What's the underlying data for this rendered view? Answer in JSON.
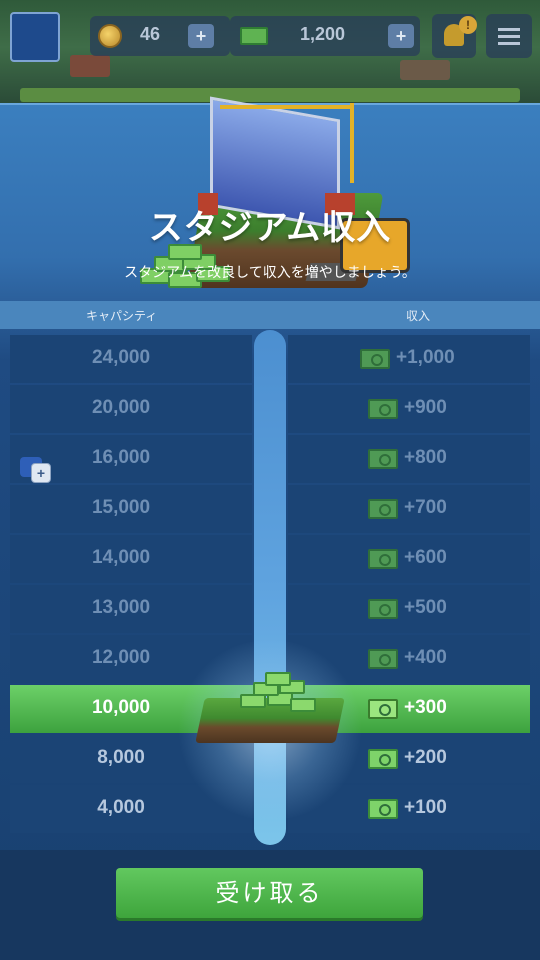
{
  "hud": {
    "coins": "46",
    "cash": "1,200",
    "coins_plus": "+",
    "cash_plus": "+",
    "notification_badge": "!"
  },
  "panel": {
    "title": "スタジアム収入",
    "subtitle": "スタジアムを改良して収入を増やしましょう。",
    "header_capacity": "キャパシティ",
    "header_income": "収入",
    "claim_label": "受け取る"
  },
  "rows": [
    {
      "capacity": "24,000",
      "income": "+1,000",
      "state": "locked"
    },
    {
      "capacity": "20,000",
      "income": "+900",
      "state": "locked"
    },
    {
      "capacity": "16,000",
      "income": "+800",
      "state": "locked"
    },
    {
      "capacity": "15,000",
      "income": "+700",
      "state": "locked"
    },
    {
      "capacity": "14,000",
      "income": "+600",
      "state": "locked"
    },
    {
      "capacity": "13,000",
      "income": "+500",
      "state": "locked"
    },
    {
      "capacity": "12,000",
      "income": "+400",
      "state": "locked"
    },
    {
      "capacity": "10,000",
      "income": "+300",
      "state": "active"
    },
    {
      "capacity": "8,000",
      "income": "+200",
      "state": "unlocked"
    },
    {
      "capacity": "4,000",
      "income": "+100",
      "state": "unlocked"
    }
  ],
  "upgrade_icon": {
    "label": "+"
  },
  "colors": {
    "active_green": "#4fb84c",
    "panel_blue": "#1b4475",
    "header_blue": "#4a86bd",
    "track_blue": "#5fa3df"
  }
}
